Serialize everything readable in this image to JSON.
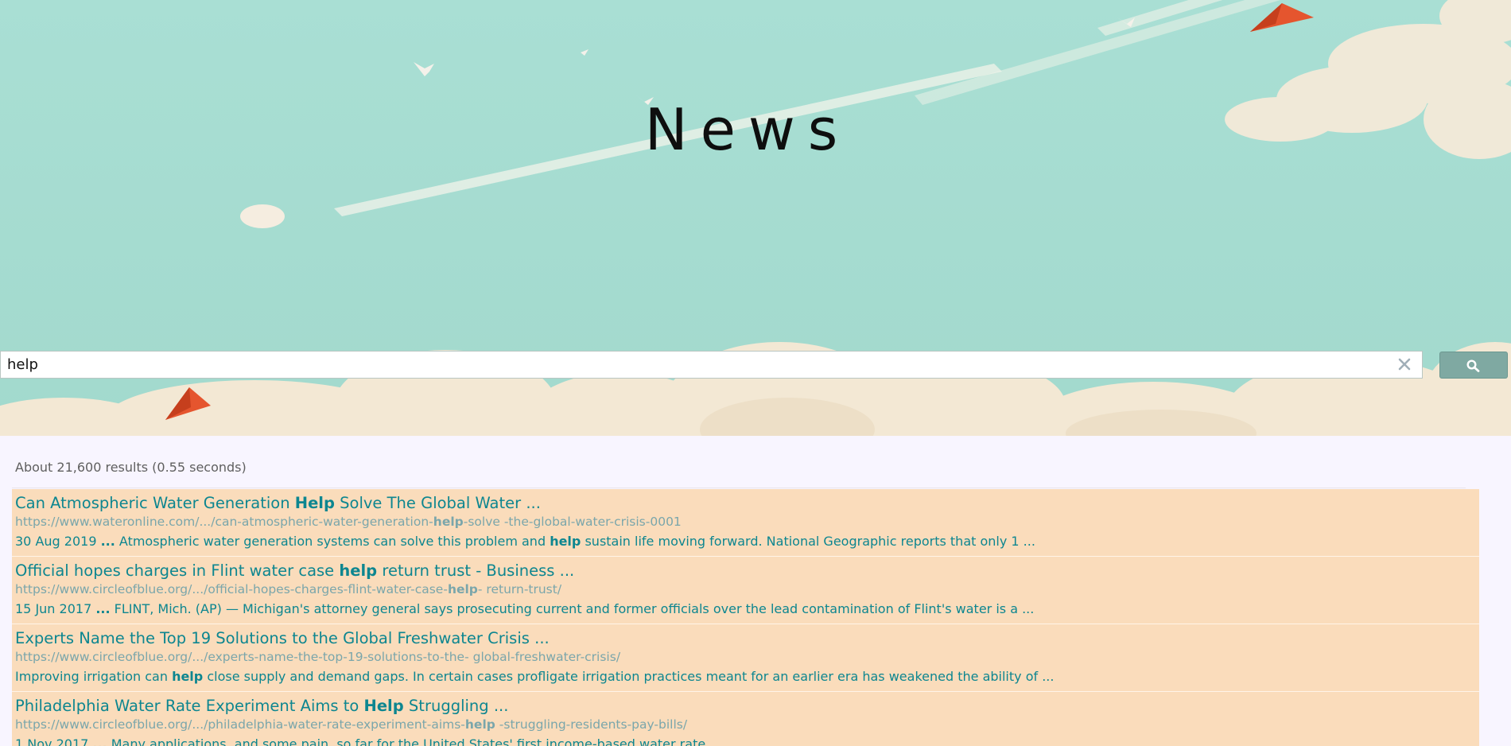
{
  "banner": {
    "title": "News"
  },
  "search": {
    "query": "help",
    "clear_icon": "close-icon",
    "button_icon": "search-icon"
  },
  "results_summary": "About 21,600 results (0.55 seconds)",
  "results": [
    {
      "title_parts": [
        "Can Atmospheric Water Generation ",
        "Help",
        " Solve The Global Water ..."
      ],
      "url_parts": [
        "https://www.wateronline.com/.../can-atmospheric-water-generation-",
        "help",
        "-solve -the-global-water-crisis-0001"
      ],
      "snippet_parts": [
        "30 Aug 2019 ",
        "...",
        " Atmospheric water generation systems can solve this problem and ",
        "help",
        " sustain life moving forward. National Geographic reports that only 1 ..."
      ]
    },
    {
      "title_parts": [
        "Official hopes charges in Flint water case ",
        "help",
        " return trust - Business ..."
      ],
      "url_parts": [
        "https://www.circleofblue.org/.../official-hopes-charges-flint-water-case-",
        "help",
        "- return-trust/"
      ],
      "snippet_parts": [
        "15 Jun 2017 ",
        "...",
        " FLINT, Mich. (AP) — Michigan's attorney general says prosecuting current and former officials over the lead contamination of Flint's water is a ..."
      ]
    },
    {
      "title_parts": [
        "Experts Name the Top 19 Solutions to the Global Freshwater Crisis ...",
        "",
        ""
      ],
      "url_parts": [
        "https://www.circleofblue.org/.../experts-name-the-top-19-solutions-to-the- global-freshwater-crisis/",
        "",
        ""
      ],
      "snippet_parts": [
        "Improving irrigation can ",
        "help",
        " close supply and demand gaps. In certain cases profligate irrigation practices meant for an earlier era has weakened the ability of  ...",
        "",
        ""
      ]
    },
    {
      "title_parts": [
        "Philadelphia Water Rate Experiment Aims to ",
        "Help",
        " Struggling ..."
      ],
      "url_parts": [
        "https://www.circleofblue.org/.../philadelphia-water-rate-experiment-aims-",
        "help",
        " -struggling-residents-pay-bills/"
      ],
      "snippet_parts": [
        "1 Nov 2017 ",
        "...",
        " Many applications, and some pain, so far for the United States' first income-based water rate ...",
        "",
        ""
      ]
    }
  ]
}
